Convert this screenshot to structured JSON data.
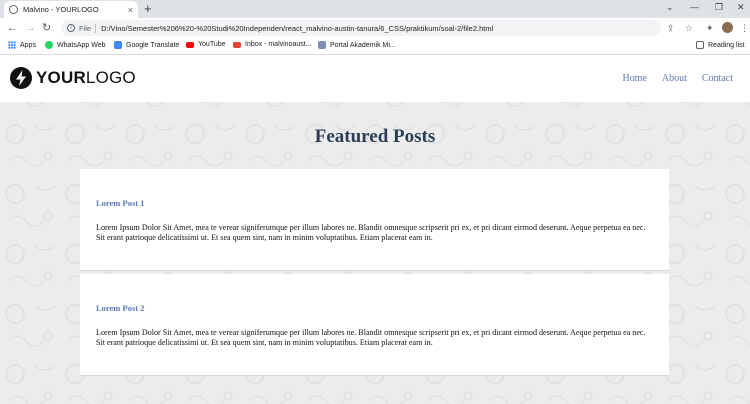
{
  "browser": {
    "tab_title": "Malvino - YOURLOGO",
    "tab_close": "×",
    "new_tab": "+",
    "address_scheme": "File",
    "address_url": "D:/Vino/Semester%206%20-%20Studi%20Independen/react_malvino-austin-tanura/6_CSS/praktikum/soal-2/file2.html",
    "bookmarks": [
      {
        "label": "Apps",
        "icon": "apps-grid-icon"
      },
      {
        "label": "WhatsApp Web",
        "icon": "whatsapp-icon",
        "color": "#25d366"
      },
      {
        "label": "Google Translate",
        "icon": "translate-icon",
        "color": "#4285f4"
      },
      {
        "label": "YouTube",
        "icon": "youtube-icon",
        "color": "#ff0000"
      },
      {
        "label": "Inbox - malvinoaust...",
        "icon": "gmail-icon",
        "color": "#ea4335"
      },
      {
        "label": "Portal Akademik Mi...",
        "icon": "portal-icon",
        "color": "#7b8fb5"
      }
    ],
    "reading_list": "Reading list"
  },
  "site": {
    "logo_bold": "YOUR",
    "logo_light": "LOGO",
    "nav": [
      "Home",
      "About",
      "Contact"
    ],
    "featured_title": "Featured Posts",
    "posts": [
      {
        "title": "Lorem Post 1",
        "body": "Lorem Ipsum Dolor Sit Amet, mea te verear signiferumque per illum labores ne. Blandit omnesque scripserit pri ex, et pri dicant eirmod deserunt. Aeque perpetua ea nec. Sit erant patrioque delicatissimi ut. Et sea quem sint, nam in minim voluptatibus. Etiam placerat eam in."
      },
      {
        "title": "Lorem Post 2",
        "body": "Lorem Ipsum Dolor Sit Amet, mea te verear signiferumque per illum labores ne. Blandit omnesque scripserit pri ex, et pri dicant eirmod deserunt. Aeque perpetua ea nec. Sit erant patrioque delicatissimi ut. Et sea quem sint, nam in minim voluptatibus. Etiam placerat eam in."
      }
    ]
  },
  "colors": {
    "link": "#5a78b4",
    "heading": "#2c3e55",
    "page_bg": "#ececec"
  }
}
